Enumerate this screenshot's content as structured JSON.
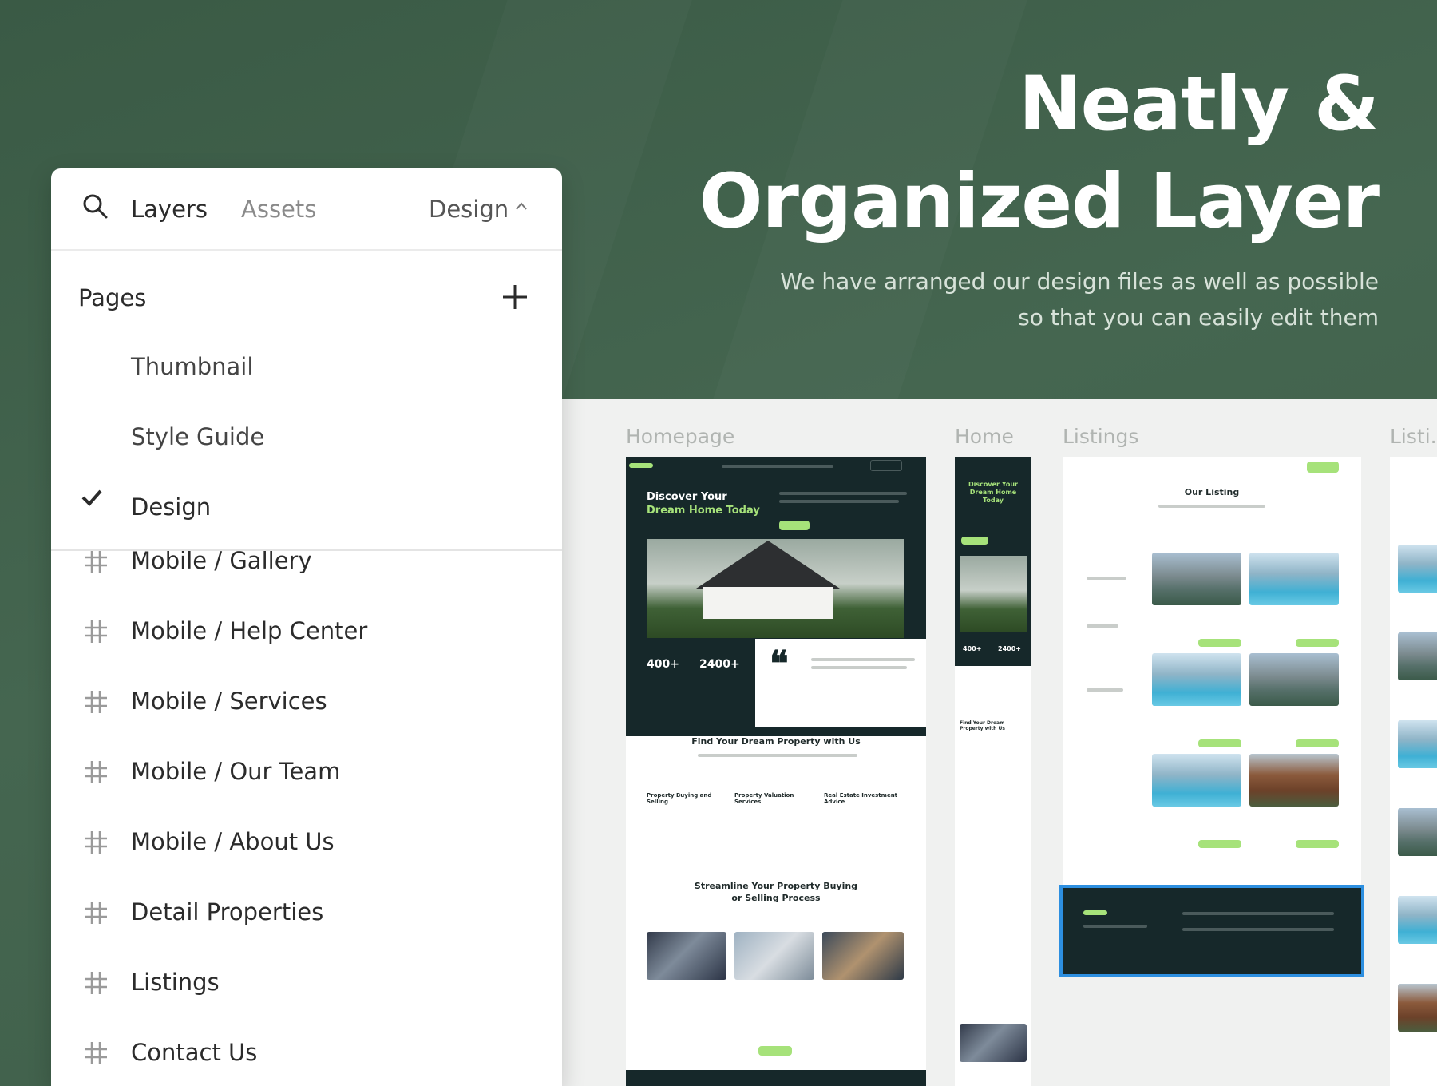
{
  "hero": {
    "title_line1": "Neatly &",
    "title_line2": "Organized Layer",
    "subtitle_line1": "We have arranged our design files as well as possible",
    "subtitle_line2": "so that you can easily edit them"
  },
  "panel": {
    "tabs": {
      "layers": "Layers",
      "assets": "Assets",
      "design": "Design"
    },
    "pages_title": "Pages",
    "pages": [
      {
        "label": "Thumbnail",
        "selected": false
      },
      {
        "label": "Style Guide",
        "selected": false
      },
      {
        "label": "Design",
        "selected": true
      }
    ],
    "layers": [
      "Mobile / Gallery",
      "Mobile / Help Center",
      "Mobile / Services",
      "Mobile / Our Team",
      "Mobile / About Us",
      "Detail Properties",
      "Listings",
      "Contact Us"
    ]
  },
  "canvas": {
    "frame_labels": [
      "Homepage",
      "Home",
      "Listings",
      "Listi..."
    ],
    "homepage": {
      "hero_line1": "Discover Your",
      "hero_line2": "Dream Home Today",
      "stat1": "400+",
      "stat2": "2400+",
      "section1": "Find Your Dream Property with Us",
      "service1": "Property Buying and Selling",
      "service2": "Property Valuation Services",
      "service3": "Real Estate Investment Advice",
      "section2_line1": "Streamline Your Property Buying",
      "section2_line2": "or Selling Process"
    },
    "mobile": {
      "hero": "Discover Your Dream Home Today",
      "stat1": "400+",
      "stat2": "2400+",
      "section1": "Find Your Dream Property with Us"
    },
    "listings": {
      "title": "Our Listing"
    }
  },
  "colors": {
    "background": "#3f5e49",
    "accent": "#a6e27a",
    "dark": "#16282a",
    "selection": "#2d8fe0"
  }
}
